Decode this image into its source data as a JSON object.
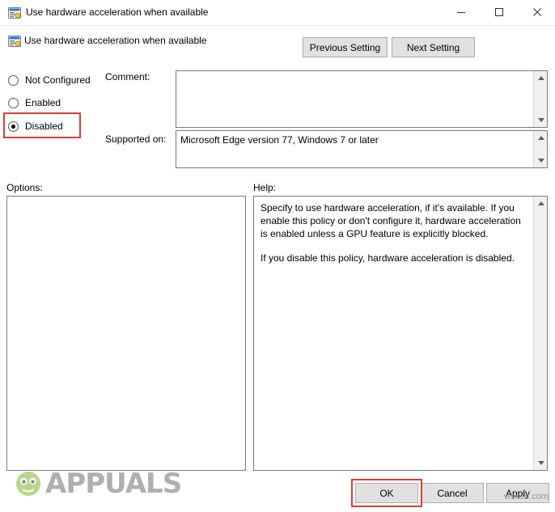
{
  "window": {
    "title": "Use hardware acceleration when available",
    "icon": "policy-setting-icon",
    "controls": {
      "minimize": "minimize-icon",
      "maximize": "maximize-icon",
      "close": "close-icon"
    }
  },
  "header": {
    "icon": "policy-setting-icon",
    "title": "Use hardware acceleration when available",
    "previous_setting": "Previous Setting",
    "next_setting": "Next Setting"
  },
  "state_options": [
    {
      "label": "Not Configured",
      "selected": false
    },
    {
      "label": "Enabled",
      "selected": false
    },
    {
      "label": "Disabled",
      "selected": true
    }
  ],
  "comment": {
    "label": "Comment:",
    "value": "",
    "placeholder": ""
  },
  "supported_on": {
    "label": "Supported on:",
    "value": "Microsoft Edge version 77, Windows 7 or later"
  },
  "options": {
    "label": "Options:",
    "value": ""
  },
  "help": {
    "label": "Help:",
    "paragraph1": "Specify to use hardware acceleration, if it's available. If you enable this policy or don't configure it, hardware acceleration is enabled unless a GPU feature is explicitly blocked.",
    "paragraph2": "If you disable this policy, hardware acceleration is disabled."
  },
  "buttons": {
    "ok": "OK",
    "cancel": "Cancel",
    "apply": "Apply"
  },
  "watermarks": {
    "brand": "APPUALS",
    "corner": "wsxdn.com"
  },
  "colors": {
    "highlight": "#e03c31",
    "button_face": "#e1e1e1",
    "button_border": "#adadad"
  }
}
